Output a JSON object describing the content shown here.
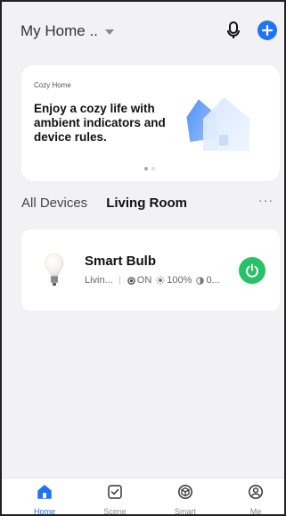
{
  "header": {
    "home_name": "My Home .."
  },
  "banner": {
    "small_title": "Cozy Home",
    "headline": "Enjoy a cozy life with ambient indicators and device rules."
  },
  "tabs": [
    {
      "label": "All Devices",
      "active": false
    },
    {
      "label": "Living Room",
      "active": true
    }
  ],
  "more_label": "···",
  "device": {
    "name": "Smart Bulb",
    "room": "Livin...",
    "state": "ON",
    "brightness": "100%",
    "extra": "0..."
  },
  "bottom_nav": [
    {
      "label": "Home",
      "icon": "home-icon",
      "active": true
    },
    {
      "label": "Scene",
      "icon": "scene-icon",
      "active": false
    },
    {
      "label": "Smart",
      "icon": "smart-icon",
      "active": false
    },
    {
      "label": "Me",
      "icon": "me-icon",
      "active": false
    }
  ],
  "colors": {
    "accent": "#1e74f5",
    "power_on": "#27c167",
    "background": "#f2f2f4"
  }
}
